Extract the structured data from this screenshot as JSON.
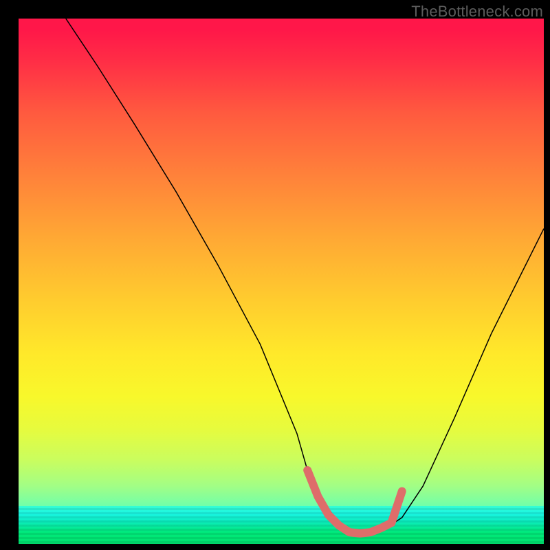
{
  "watermark": {
    "text": "TheBottleneck.com"
  },
  "chart_data": {
    "type": "line",
    "title": "",
    "xlabel": "",
    "ylabel": "",
    "xlim": [
      0,
      100
    ],
    "ylim": [
      0,
      100
    ],
    "grid": false,
    "background": {
      "style": "vertical-gradient",
      "stops": [
        {
          "pos": 0.0,
          "color": "#ff1749"
        },
        {
          "pos": 0.18,
          "color": "#ff5a3f"
        },
        {
          "pos": 0.42,
          "color": "#ffa934"
        },
        {
          "pos": 0.64,
          "color": "#ffe92a"
        },
        {
          "pos": 0.84,
          "color": "#cafd5e"
        },
        {
          "pos": 0.97,
          "color": "#22f8ed"
        },
        {
          "pos": 1.0,
          "color": "#00e97a"
        }
      ]
    },
    "series": [
      {
        "name": "bottleneck-curve",
        "color": "#000000",
        "stroke_width": 1.5,
        "x": [
          9,
          15,
          22,
          30,
          38,
          46,
          53,
          55,
          58,
          61,
          64,
          67,
          70,
          73,
          77,
          83,
          90,
          97,
          100
        ],
        "y": [
          100,
          91,
          80,
          67,
          53,
          38,
          21,
          14,
          8,
          4,
          2,
          2,
          3,
          5,
          11,
          24,
          40,
          54,
          60
        ]
      },
      {
        "name": "valley-highlight",
        "color": "#de6d6a",
        "stroke_width": 12,
        "linecap": "round",
        "x": [
          55,
          57,
          59,
          61,
          63,
          65,
          67,
          69,
          71,
          72,
          73
        ],
        "y": [
          14,
          9,
          5.5,
          3.5,
          2.2,
          2,
          2.2,
          3,
          4,
          7,
          10
        ]
      }
    ]
  }
}
